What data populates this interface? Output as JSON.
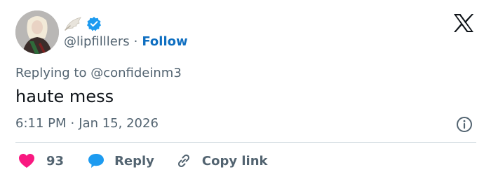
{
  "tweet": {
    "handle": "@lipfilllers",
    "separator": "·",
    "follow_label": "Follow",
    "reply_prefix": "Replying to",
    "reply_mention": "@confideinm3",
    "text": "haute mess",
    "time": "6:11 PM",
    "date": "Jan 15, 2026"
  },
  "actions": {
    "likes": "93",
    "reply_label": "Reply",
    "copy_label": "Copy link"
  },
  "colors": {
    "like": "#f91880",
    "reply": "#1d9bf0",
    "verified": "#1d9bf0",
    "follow": "#0f6fc1",
    "muted": "#536471",
    "text": "#0f1419",
    "divider": "#cfd9de"
  },
  "icons": [
    "profile-avatar",
    "wing-emoji-icon",
    "verified-badge-icon",
    "x-logo-icon",
    "info-icon",
    "heart-icon",
    "reply-bubble-icon",
    "link-icon"
  ]
}
